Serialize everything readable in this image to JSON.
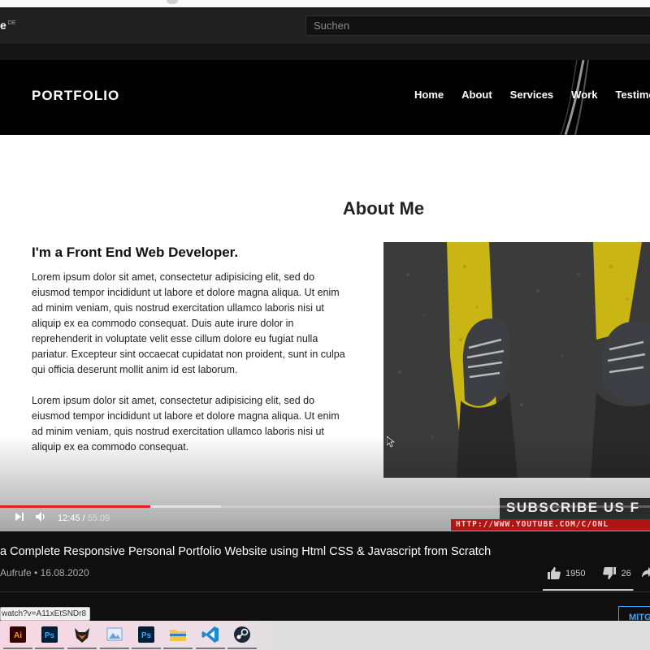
{
  "youtube": {
    "logo_text": "e",
    "logo_region": "DE",
    "search_placeholder": "Suchen"
  },
  "video_frame": {
    "site_brand": "PORTFOLIO",
    "nav_items": [
      "Home",
      "About",
      "Services",
      "Work",
      "Testimo"
    ],
    "about_heading": "About Me",
    "about_subtitle": "I'm a Front End Web Developer.",
    "paragraph_1": "Lorem ipsum dolor sit amet, consectetur adipisicing elit, sed do eiusmod tempor incididunt ut labore et dolore magna aliqua. Ut enim ad minim veniam, quis nostrud exercitation ullamco laboris nisi ut aliquip ex ea commodo consequat. Duis aute irure dolor in reprehenderit in voluptate velit esse cillum dolore eu fugiat nulla pariatur. Excepteur sint occaecat cupidatat non proident, sunt in culpa qui officia deserunt mollit anim id est laborum.",
    "paragraph_2": "Lorem ipsum dolor sit amet, consectetur adipisicing elit, sed do eiusmod tempor incididunt ut labore et dolore magna aliqua. Ut enim ad minim veniam, quis nostrud exercitation ullamco laboris nisi ut aliquip ex ea commodo consequat.",
    "subscribe_banner": "SUBSCRIBE US F",
    "channel_url_banner": "HTTP://WWW.YOUTUBE.COM/C/ONL"
  },
  "player": {
    "current_time": "12:45",
    "duration": "55:09",
    "played_fraction": 0.231,
    "buffered_fraction": 0.34,
    "accent_color": "#e0201a"
  },
  "video_info": {
    "title": "a Complete Responsive Personal Portfolio Website using Html CSS & Javascript from Scratch",
    "views_label": "Aufrufe",
    "date": "16.08.2020",
    "likes": "1950",
    "dislikes": "26",
    "like_ratio": 0.987,
    "join_button": "MITG"
  },
  "status_url": "watch?v=A11xEtSNDr8",
  "taskbar": {
    "apps": [
      {
        "name": "illustrator",
        "label": "Ai",
        "color": "#ff9a00"
      },
      {
        "name": "photoshop",
        "label": "Ps",
        "color": "#31a8ff"
      },
      {
        "name": "fox-app",
        "label": "",
        "color": "#e66b1a"
      },
      {
        "name": "image-viewer",
        "label": "",
        "color": "#6a9fd8"
      },
      {
        "name": "photoshop-2",
        "label": "Ps",
        "color": "#31a8ff"
      },
      {
        "name": "file-explorer",
        "label": "",
        "color": "#f5c542"
      },
      {
        "name": "vscode",
        "label": "",
        "color": "#1f8ad2"
      },
      {
        "name": "steam",
        "label": "",
        "color": "#1b2838"
      }
    ]
  }
}
